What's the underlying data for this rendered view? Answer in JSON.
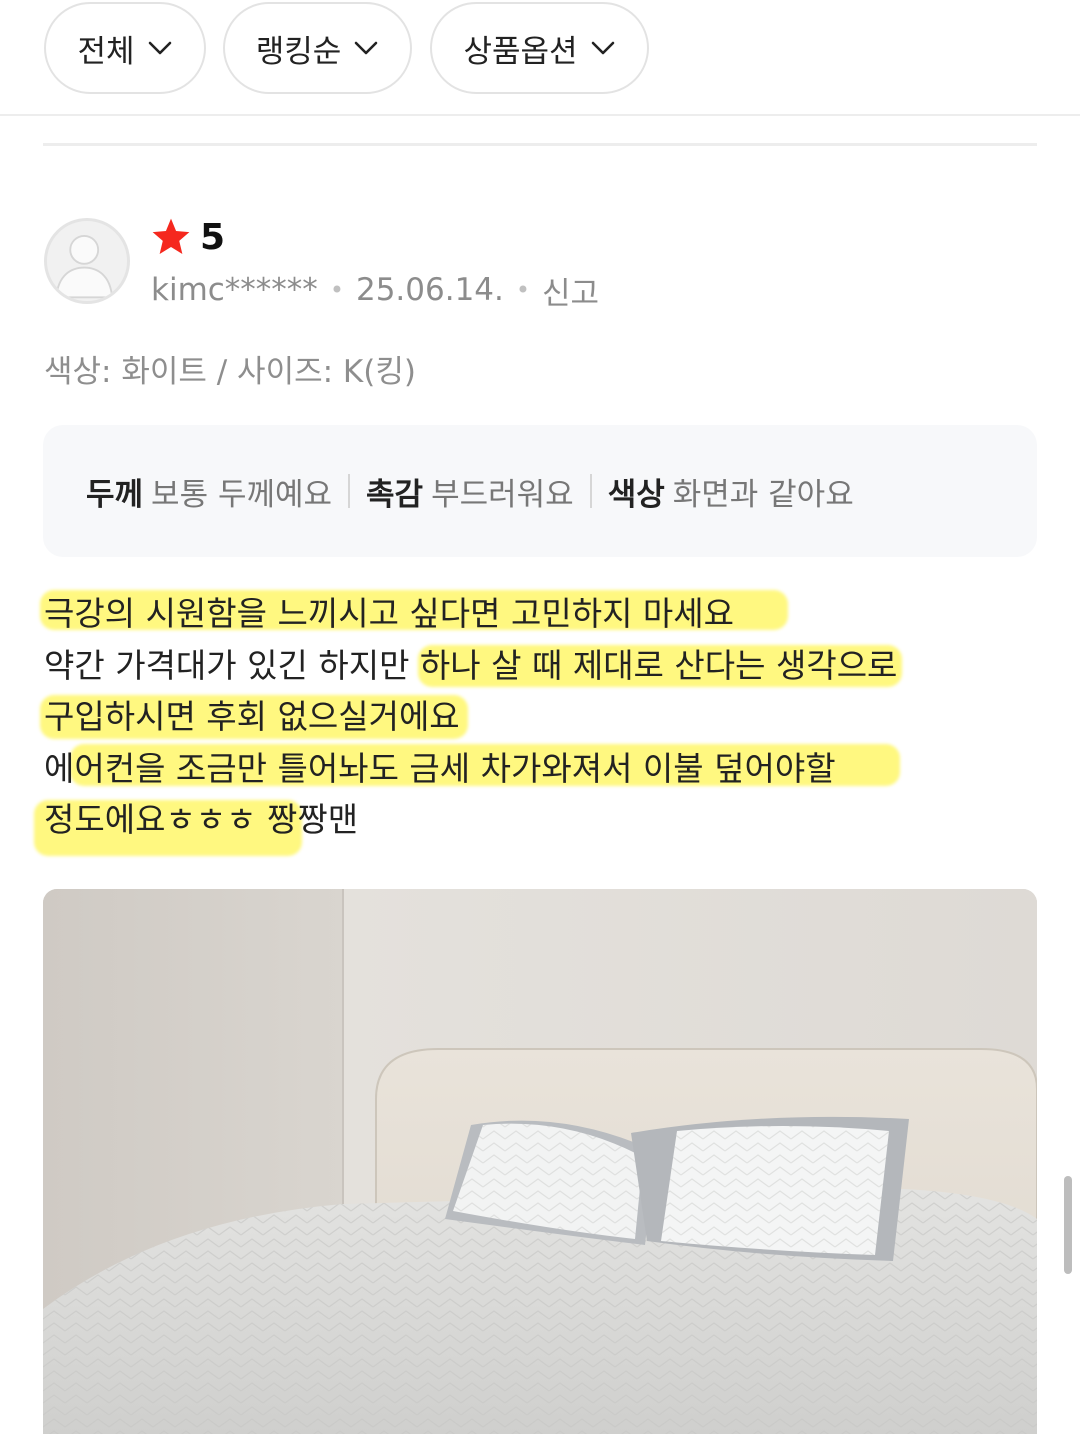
{
  "filters": [
    {
      "label": "전체"
    },
    {
      "label": "랭킹순"
    },
    {
      "label": "상품옵션"
    }
  ],
  "review": {
    "rating": "5",
    "user": "kimc******",
    "date": "25.06.14.",
    "report_label": "신고",
    "option": "색상: 화이트 / 사이즈: K(킹)",
    "evaluations": [
      {
        "key": "두께",
        "value": "보통 두께예요"
      },
      {
        "key": "촉감",
        "value": "부드러워요"
      },
      {
        "key": "색상",
        "value": "화면과 같아요"
      }
    ],
    "lines": [
      "극강의 시원함을 느끼시고 싶다면 고민하지 마세요",
      "약간 가격대가 있긴 하지만 하나 살 때 제대로 산다는 생각으로",
      "구입하시면 후회 없으실거에요",
      "에어컨을 조금만 틀어놔도 금세 차가와져서 이불 덮어야할",
      "정도에요ㅎㅎㅎ 짱짱맨"
    ]
  },
  "colors": {
    "star": "#f5281e",
    "highlight": "#fff65c",
    "eval_bg": "#f7f8fa"
  }
}
